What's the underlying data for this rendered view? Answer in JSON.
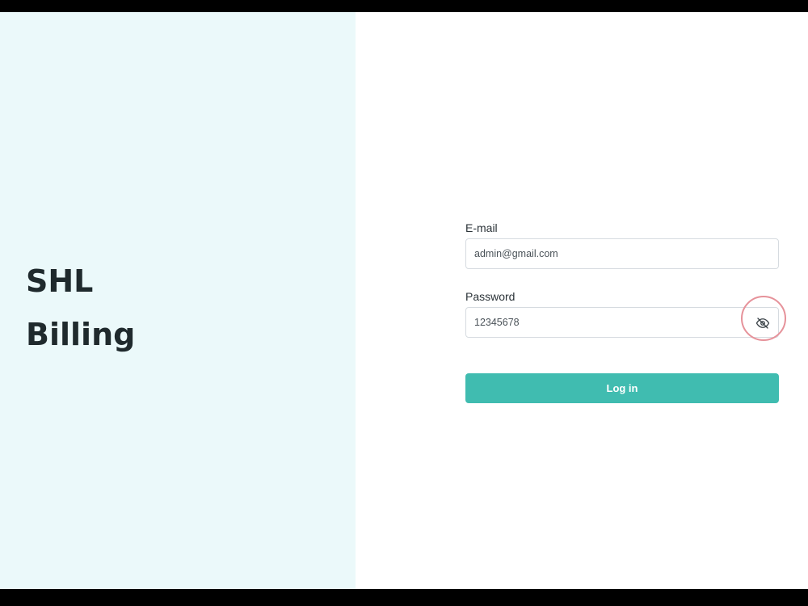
{
  "brand": {
    "line1": "SHL",
    "line2": "Billing"
  },
  "login_form": {
    "email": {
      "label": "E-mail",
      "value": "admin@gmail.com"
    },
    "password": {
      "label": "Password",
      "value": "12345678",
      "toggle_icon": "eye-slash-icon"
    },
    "submit_label": "Log in"
  },
  "colors": {
    "left_panel_bg": "#ebf9fa",
    "accent": "#40bcb0",
    "highlight_ring": "#e6929a"
  }
}
